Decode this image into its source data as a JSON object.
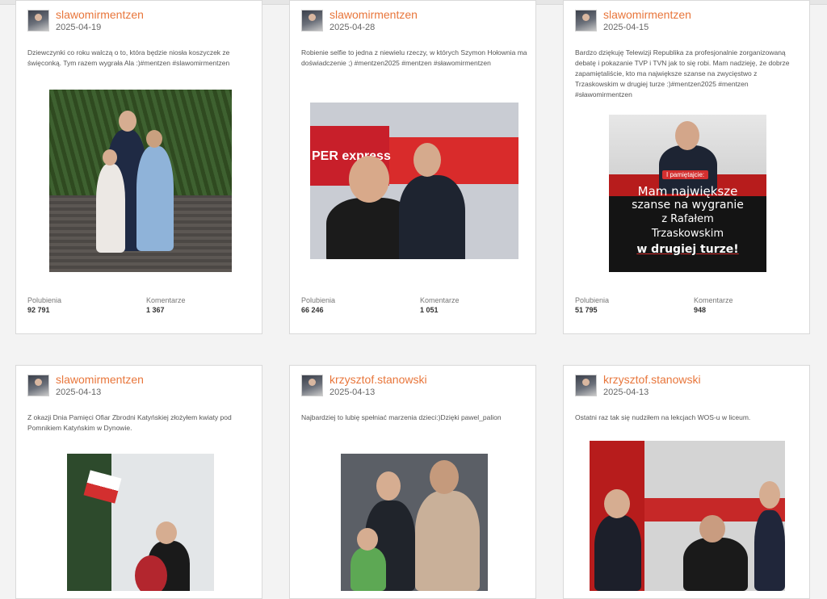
{
  "stats_labels": {
    "likes": "Polubienia",
    "comments": "Komentarze"
  },
  "posts": [
    {
      "username": "slawomirmentzen",
      "date": "2025-04-19",
      "caption": "Dziewczynki co roku walczą o to, która będzie niosła koszyczek ze święconką. Tym razem wygrała Ala :)#mentzen #slawomirmentzen",
      "likes": "92 791",
      "comments": "1 367"
    },
    {
      "username": "slawomirmentzen",
      "date": "2025-04-28",
      "caption": "Robienie selfie to jedna z niewielu rzeczy, w których Szymon Hołownia ma doświadczenie ;) #mentzen2025 #mentzen #sławomirmentzen",
      "likes": "66 246",
      "comments": "1 051",
      "image_text": "PER express"
    },
    {
      "username": "slawomirmentzen",
      "date": "2025-04-15",
      "caption": "Bardzo dziękuję Telewizji Republika za profesjonalnie zorganizowaną debatę i pokazanie TVP i TVN jak to się robi. Mam nadzieję, że dobrze zapamiętaliście, kto ma największe szanse na zwycięstwo z Trzaskowskim w drugiej turze :)#mentzen2025 #mentzen #sławomirmentzen",
      "likes": "51 795",
      "comments": "948",
      "poster": {
        "tag": "I pamiętajcie:",
        "line1": "Mam największe",
        "line2": "szanse na wygranie",
        "line3": "z Rafałem",
        "line4": "Trzaskowskim",
        "line5": "w drugiej turze!"
      }
    },
    {
      "username": "slawomirmentzen",
      "date": "2025-04-13",
      "caption": "Z okazji Dnia Pamięci Ofiar Zbrodni Katyńskiej złożyłem kwiaty pod Pomnikiem Katyńskim w Dynowie."
    },
    {
      "username": "krzysztof.stanowski",
      "date": "2025-04-13",
      "caption": "Najbardziej to lubię spełniać marzenia dzieci:)Dzięki pawel_palion"
    },
    {
      "username": "krzysztof.stanowski",
      "date": "2025-04-13",
      "caption": "Ostatni raz tak się nudziłem na lekcjach WOS-u w liceum."
    }
  ],
  "colors": {
    "username": "#e8763b",
    "accent_red": "#d32f2f"
  },
  "icons": {
    "avatar": "profile-avatar"
  }
}
